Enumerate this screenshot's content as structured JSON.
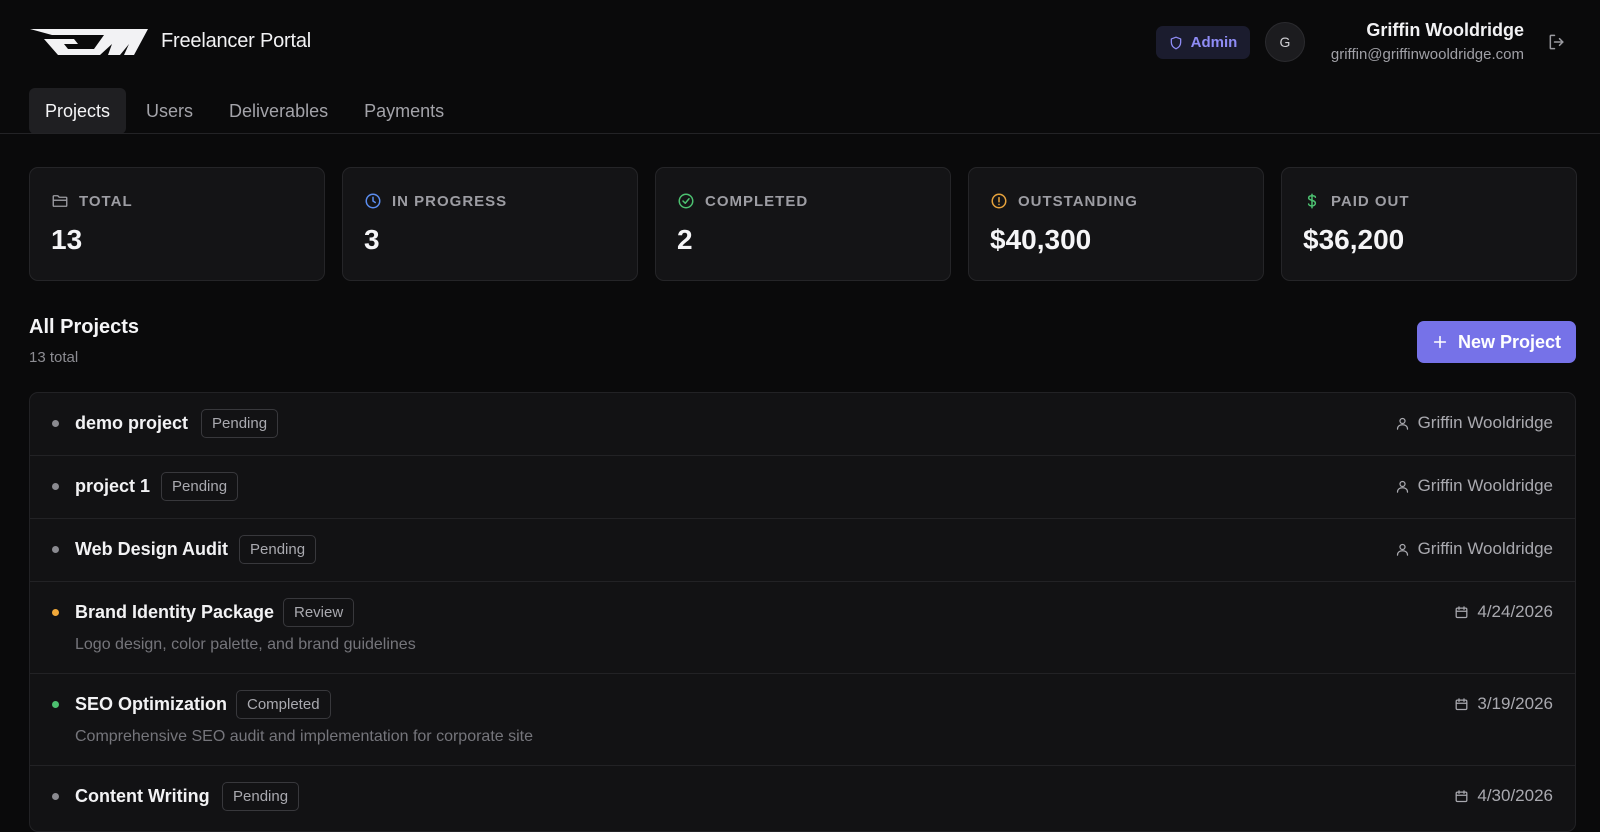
{
  "header": {
    "app_title": "Freelancer Portal",
    "role_badge": "Admin",
    "avatar_initial": "G",
    "user_name": "Griffin Wooldridge",
    "user_email": "griffin@griffinwooldridge.com"
  },
  "tabs": [
    {
      "label": "Projects",
      "active": true
    },
    {
      "label": "Users",
      "active": false
    },
    {
      "label": "Deliverables",
      "active": false
    },
    {
      "label": "Payments",
      "active": false
    }
  ],
  "stats": [
    {
      "label": "TOTAL",
      "value": "13",
      "icon": "folder-icon",
      "color": "#9d9da3"
    },
    {
      "label": "IN PROGRESS",
      "value": "3",
      "icon": "clock-icon",
      "color": "#5b8def"
    },
    {
      "label": "COMPLETED",
      "value": "2",
      "icon": "check-circle-icon",
      "color": "#4cc070"
    },
    {
      "label": "OUTSTANDING",
      "value": "$40,300",
      "icon": "alert-circle-icon",
      "color": "#e6a23c"
    },
    {
      "label": "PAID OUT",
      "value": "$36,200",
      "icon": "dollar-icon",
      "color": "#4cc070"
    }
  ],
  "section": {
    "title": "All Projects",
    "subtitle": "13 total",
    "new_button_label": "New Project"
  },
  "projects": [
    {
      "name": "demo project",
      "status": "Pending",
      "dot_color": "#8a8a90",
      "meta": "Griffin Wooldridge",
      "meta_icon": "user-icon",
      "description": ""
    },
    {
      "name": "project 1",
      "status": "Pending",
      "dot_color": "#8a8a90",
      "meta": "Griffin Wooldridge",
      "meta_icon": "user-icon",
      "description": ""
    },
    {
      "name": "Web Design Audit",
      "status": "Pending",
      "dot_color": "#8a8a90",
      "meta": "Griffin Wooldridge",
      "meta_icon": "user-icon",
      "description": ""
    },
    {
      "name": "Brand Identity Package",
      "status": "Review",
      "dot_color": "#f0a83a",
      "meta": "4/24/2026",
      "meta_icon": "calendar-icon",
      "description": "Logo design, color palette, and brand guidelines"
    },
    {
      "name": "SEO Optimization",
      "status": "Completed",
      "dot_color": "#4cc070",
      "meta": "3/19/2026",
      "meta_icon": "calendar-icon",
      "description": "Comprehensive SEO audit and implementation for corporate site"
    },
    {
      "name": "Content Writing",
      "status": "Pending",
      "dot_color": "#8a8a90",
      "meta": "4/30/2026",
      "meta_icon": "calendar-icon",
      "description": ""
    }
  ]
}
